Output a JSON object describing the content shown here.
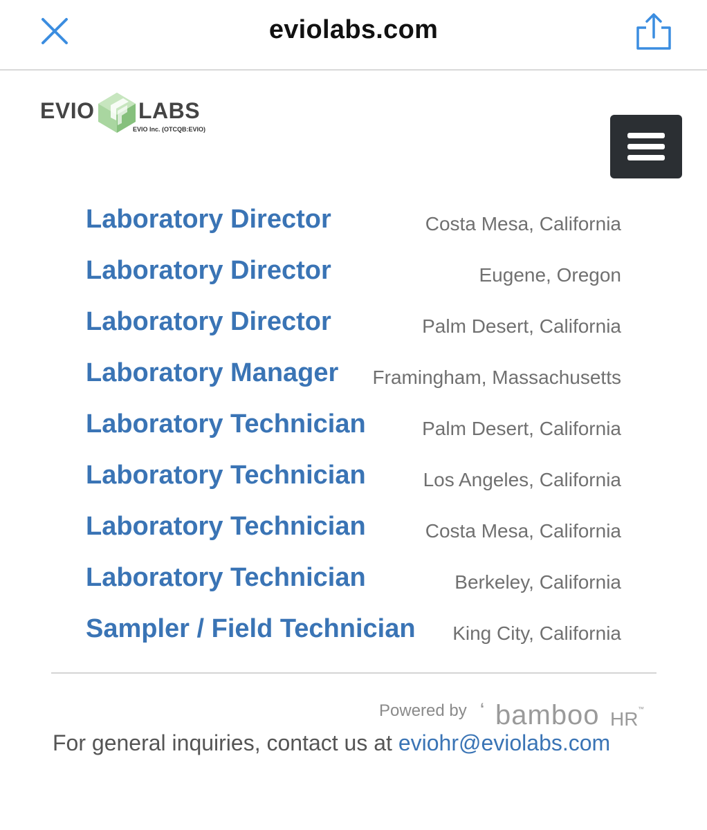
{
  "browser": {
    "domain": "eviolabs.com",
    "close_icon": "close-icon",
    "share_icon": "share-icon"
  },
  "header": {
    "logo": {
      "left_word": "EVIO",
      "right_word": "LABS",
      "subtitle": "EVIO Inc. (OTCQB:EVIO)",
      "mark_color": "#8fc98a"
    },
    "menu_icon": "hamburger-menu-icon"
  },
  "jobs": [
    {
      "title": "Laboratory Director",
      "location": "Costa Mesa, California"
    },
    {
      "title": "Laboratory Director",
      "location": "Eugene, Oregon"
    },
    {
      "title": "Laboratory Director",
      "location": "Palm Desert, California"
    },
    {
      "title": "Laboratory Manager",
      "location": "Framingham, Massachusetts"
    },
    {
      "title": "Laboratory Technician",
      "location": "Palm Desert, California"
    },
    {
      "title": "Laboratory Technician",
      "location": "Los Angeles, California"
    },
    {
      "title": "Laboratory Technician",
      "location": "Costa Mesa, California"
    },
    {
      "title": "Laboratory Technician",
      "location": "Berkeley, California"
    },
    {
      "title": "Sampler / Field Technician",
      "location": "King City, California"
    }
  ],
  "footer": {
    "powered_by": "Powered by",
    "bamboo_word": "bamboo",
    "hr_word": "HR",
    "tm": "™",
    "inquiries_text": "For general inquiries, contact us at ",
    "email": "eviohr@eviolabs.com"
  },
  "colors": {
    "link": "#3a74b5",
    "browser_accent": "#3b8de0",
    "menu_button_bg": "#2b2f33",
    "location_text": "#707070"
  }
}
